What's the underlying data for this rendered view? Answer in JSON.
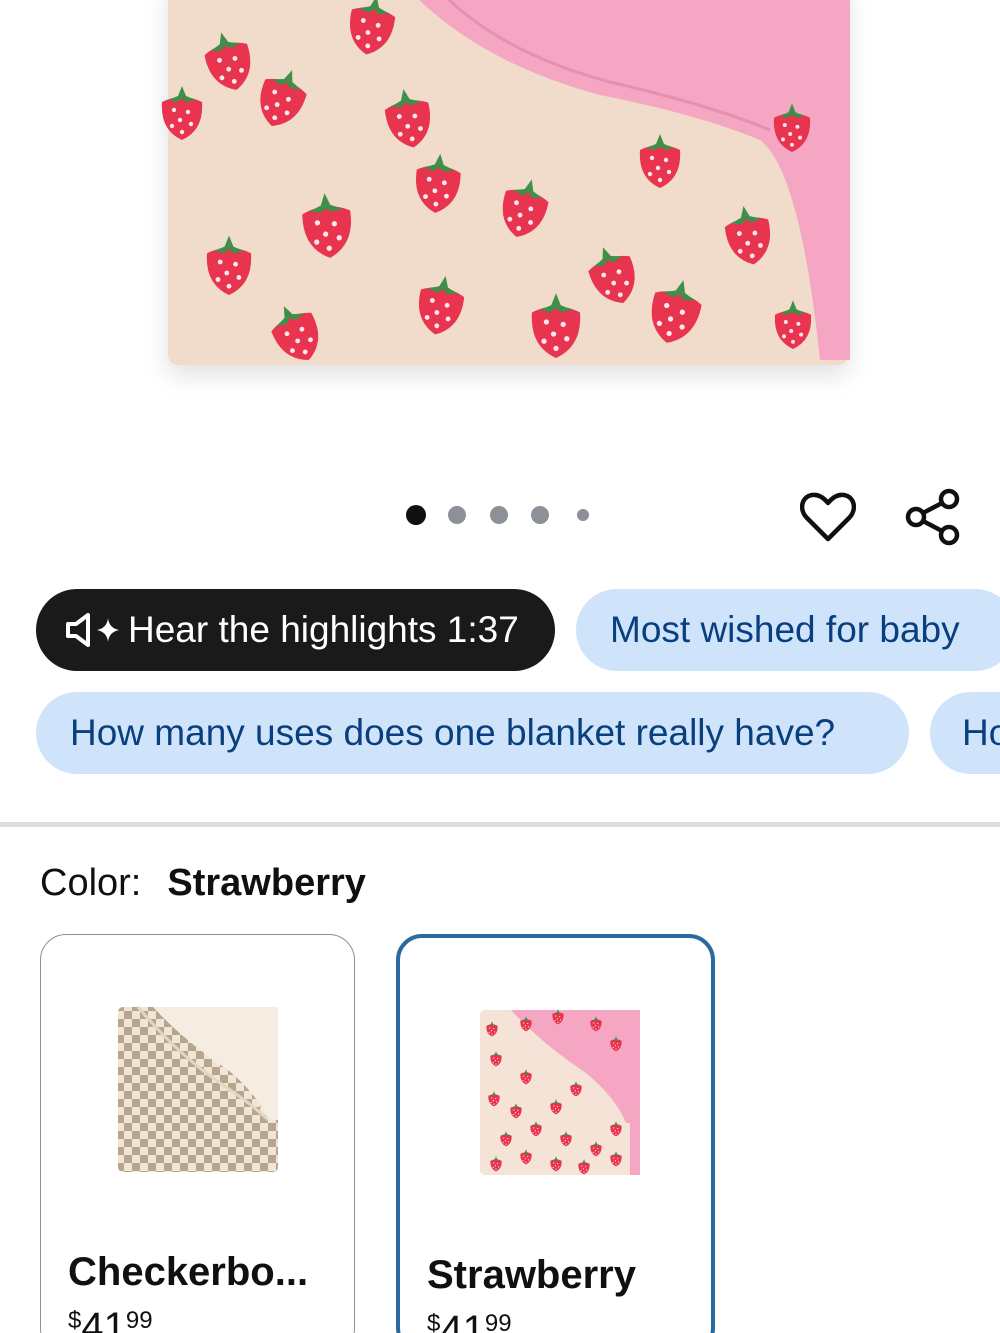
{
  "media": {
    "product_image_alt": "",
    "carousel": {
      "count": 5,
      "active_index": 0
    }
  },
  "actions": {
    "wishlist_icon": "heart-icon",
    "share_icon": "share-icon"
  },
  "chips": {
    "audio": {
      "icon": "speaker-sparkle-icon",
      "label": "Hear the highlights 1:37"
    },
    "row1": [
      {
        "label": "Most wished for baby"
      }
    ],
    "row2": [
      {
        "label": "How many uses does one blanket really have?"
      },
      {
        "label": "Ho"
      }
    ]
  },
  "variation": {
    "label": "Color:",
    "selected": "Strawberry",
    "options": [
      {
        "name": "Checkerbo...",
        "price_symbol": "$",
        "price_whole": "41",
        "price_fraction": "99",
        "selected": false
      },
      {
        "name": "Strawberry",
        "price_symbol": "$",
        "price_whole": "41",
        "price_fraction": "99",
        "selected": true
      }
    ]
  },
  "colors": {
    "accent_selected_border": "#2a6aa0",
    "chip_light_bg": "#cfe4fb",
    "chip_light_text": "#0a3f7f",
    "chip_dark_bg": "#1a1a1a",
    "strawberry_red": "#e8344e",
    "blanket_cream": "#f1dccb",
    "blanket_pink": "#f4a6c2"
  }
}
